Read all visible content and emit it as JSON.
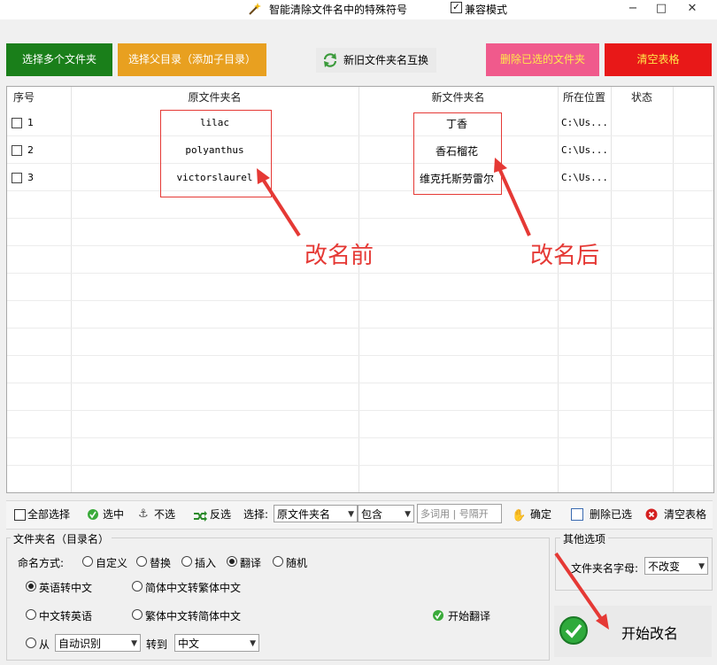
{
  "titlebar": {
    "title": "智能清除文件名中的特殊符号",
    "compat_mode": "兼容模式",
    "minimize": "−",
    "maximize": "□",
    "close": "✕"
  },
  "toolbar": {
    "select_folders": "选择多个文件夹",
    "select_parent": "选择父目录（添加子目录）",
    "swap_names": "新旧文件夹名互换",
    "delete_selected": "删除已选的文件夹",
    "clear_table": "清空表格"
  },
  "table": {
    "headers": [
      "序号",
      "原文件夹名",
      "新文件夹名",
      "所在位置",
      "状态"
    ],
    "rows": [
      {
        "num": "1",
        "original": "lilac",
        "new": "丁香",
        "location": "C:\\Us...",
        "status": ""
      },
      {
        "num": "2",
        "original": "polyanthus",
        "new": "香石榴花",
        "location": "C:\\Us...",
        "status": ""
      },
      {
        "num": "3",
        "original": "victorslaurel",
        "new": "维克托斯劳雷尔",
        "location": "C:\\Us...",
        "status": ""
      }
    ]
  },
  "annotations": {
    "before": "改名前",
    "after": "改名后"
  },
  "filterbar": {
    "select_all": "全部选择",
    "check": "选中",
    "uncheck": "不选",
    "invert": "反选",
    "select_label": "选择:",
    "field_value": "原文件夹名",
    "match_value": "包含",
    "keyword_placeholder": "多词用 | 号隔开",
    "confirm": "确定",
    "delete_selected": "删除已选",
    "clear_table": "清空表格"
  },
  "options": {
    "group_title": "文件夹名（目录名）",
    "naming_label": "命名方式:",
    "naming_modes": [
      "自定义",
      "替换",
      "插入",
      "翻译",
      "随机"
    ],
    "naming_selected": "翻译",
    "en_to_cn": "英语转中文",
    "cn_to_en": "中文转英语",
    "simp_to_trad": "简体中文转繁体中文",
    "trad_to_simp": "繁体中文转简体中文",
    "from_label": "从",
    "from_value": "自动识别",
    "to_label": "转到",
    "to_value": "中文",
    "start_translate": "开始翻译"
  },
  "other": {
    "group_title": "其他选项",
    "case_label": "文件夹名字母:",
    "case_value": "不改变",
    "start_rename": "开始改名"
  },
  "colors": {
    "btn_green": "#1a7f1a",
    "btn_orange": "#e8a020",
    "btn_pink": "#f05a8c",
    "btn_red": "#e81818",
    "annotation_red": "#e53935"
  }
}
